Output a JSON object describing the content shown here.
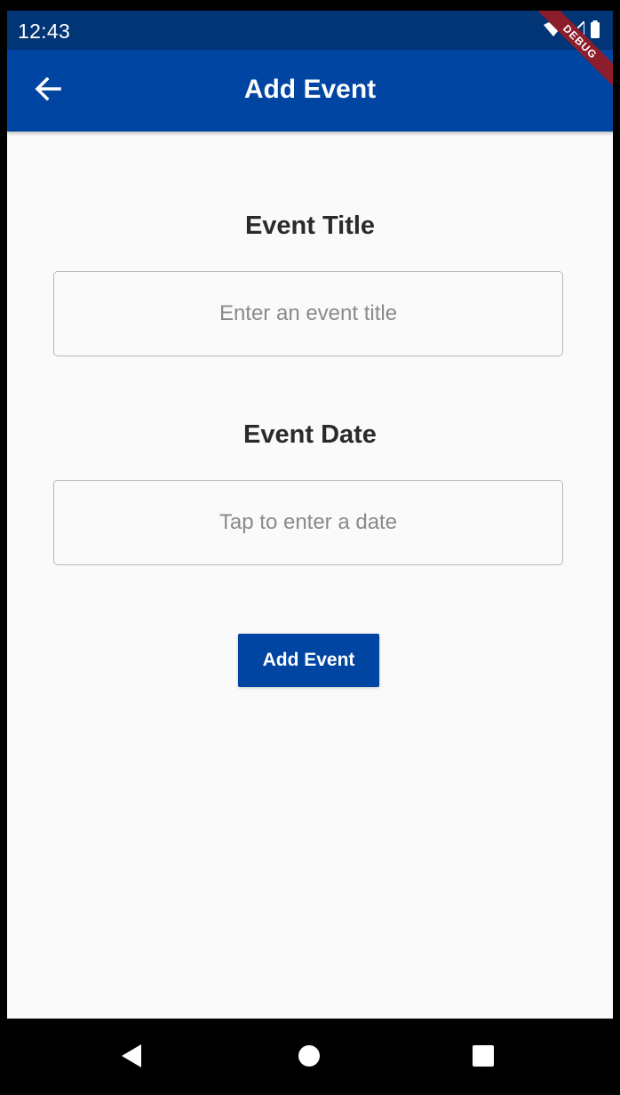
{
  "status_bar": {
    "time": "12:43",
    "icons": [
      "wifi-icon",
      "signal-icon",
      "battery-icon"
    ],
    "debug_label": "DEBUG"
  },
  "app_bar": {
    "title": "Add Event",
    "back_icon": "arrow-left-icon"
  },
  "form": {
    "title_section": {
      "label": "Event Title",
      "value": "",
      "placeholder": "Enter an event title"
    },
    "date_section": {
      "label": "Event Date",
      "value": "",
      "placeholder": "Tap to enter a date"
    },
    "submit_label": "Add Event"
  },
  "nav_bar": {
    "icons": [
      "back-triangle-icon",
      "home-circle-icon",
      "recents-square-icon"
    ]
  },
  "colors": {
    "status_bar": "#013575",
    "primary": "#0145a3",
    "background": "#fafafa",
    "debug_ribbon": "#8c1d2b",
    "field_border": "#b8b8b8"
  }
}
